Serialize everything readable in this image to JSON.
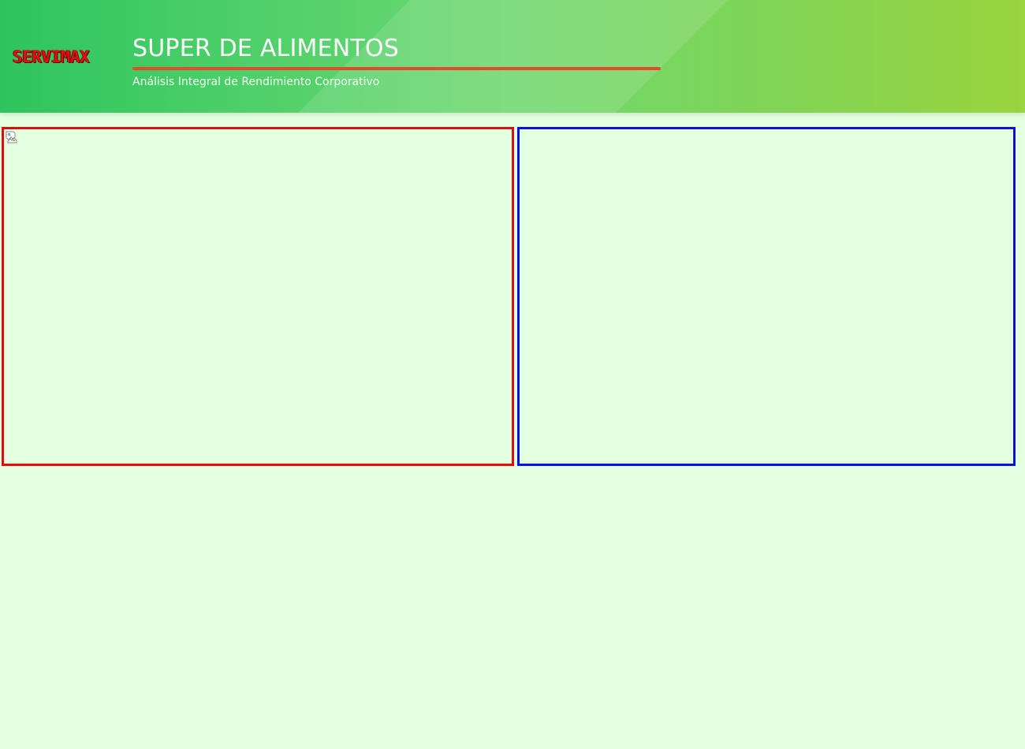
{
  "header": {
    "logo_text": "SERVIMAX",
    "title": "SUPER DE ALIMENTOS",
    "subtitle": "Análisis Integral de Rendimiento Corporativo"
  },
  "panels": {
    "left": {
      "border_color": "#e00d0d",
      "content_icon": "broken-image-icon"
    },
    "right": {
      "border_color": "#0a10e0"
    }
  },
  "colors": {
    "background": "#e3ffdf",
    "accent_line": "#e34b2a",
    "header_gradient_start": "#2ec45d",
    "header_gradient_end": "#9ad43e"
  }
}
